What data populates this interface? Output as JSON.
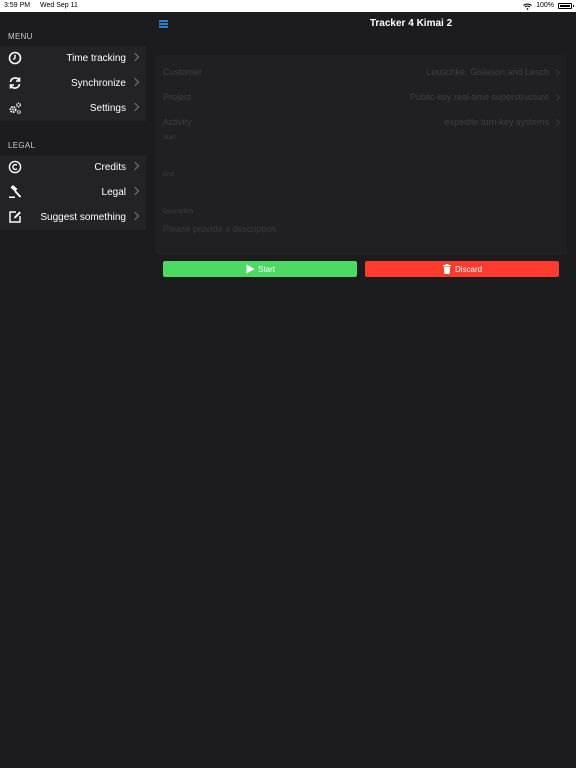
{
  "status_bar": {
    "time": "3:59 PM",
    "date": "Wed Sep 11",
    "battery": "100%"
  },
  "sidebar": {
    "menu_header": "MENU",
    "menu_items": [
      {
        "label": "Time tracking",
        "icon": "clock-icon"
      },
      {
        "label": "Synchronize",
        "icon": "sync-icon"
      },
      {
        "label": "Settings",
        "icon": "gears-icon"
      }
    ],
    "legal_header": "LEGAL",
    "legal_items": [
      {
        "label": "Credits",
        "icon": "copyright-icon"
      },
      {
        "label": "Legal",
        "icon": "gavel-icon"
      },
      {
        "label": "Suggest something",
        "icon": "edit-icon"
      }
    ]
  },
  "navbar": {
    "title": "Tracker 4 Kimai 2"
  },
  "form": {
    "customer_label": "Customer",
    "customer_value": "Leuschke, Gislason and Lesch",
    "project_label": "Project",
    "project_value": "Public-key real-time superstructure",
    "activity_label": "Activity",
    "activity_value": "expedite turn-key systems",
    "start_label": "Start",
    "end_label": "End",
    "description_label": "Description",
    "description_placeholder": "Please provide a description"
  },
  "actions": {
    "start_label": "Start",
    "discard_label": "Discard"
  },
  "colors": {
    "start_button": "#4cd964",
    "discard_button": "#ff3b30",
    "accent": "#2d7dd2"
  }
}
